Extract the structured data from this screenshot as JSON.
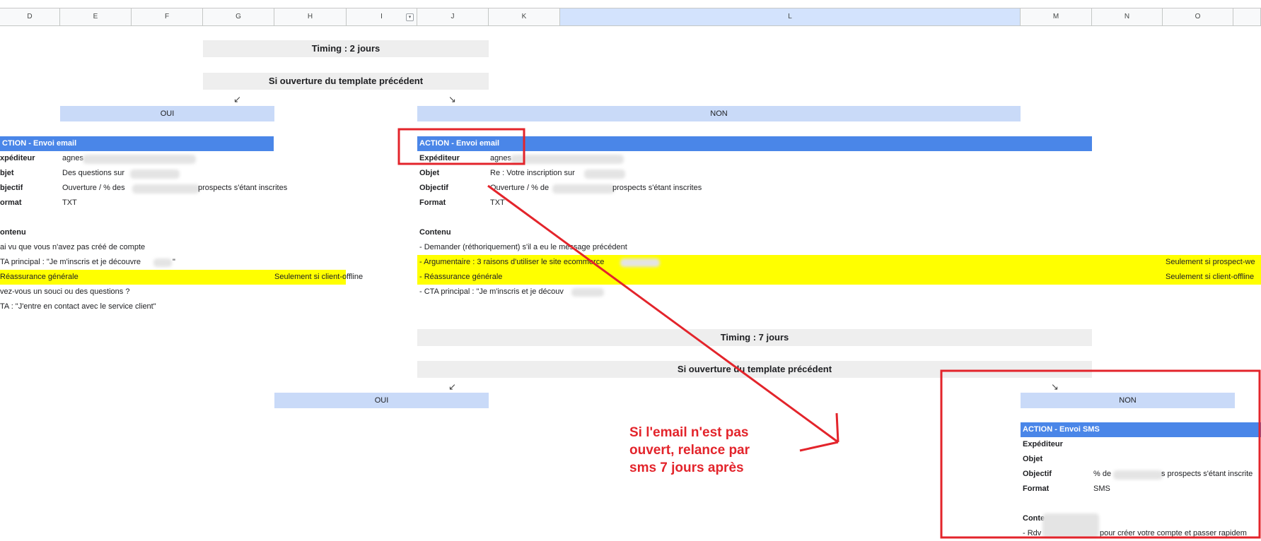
{
  "columns": [
    "D",
    "E",
    "F",
    "G",
    "H",
    "I",
    "J",
    "K",
    "L",
    "M",
    "N",
    "O"
  ],
  "timing1": "Timing : 2 jours",
  "condition1": "Si ouverture du template précédent",
  "arrow_down_left": "↙",
  "arrow_down_right": "↘",
  "branch_yes": "OUI",
  "branch_no": "NON",
  "left_block": {
    "action": "CTION -  Envoi email",
    "expediteur_label": "xpéditeur",
    "expediteur_value": "agnes",
    "objet_label": "bjet",
    "objet_value": "Des questions sur",
    "objectif_label": "bjectif",
    "objectif_value_a": "Ouverture / % des",
    "objectif_value_b": "prospects s'étant inscrites",
    "format_label": "ormat",
    "format_value": "TXT",
    "contenu_label": "ontenu",
    "lines": [
      "ai vu que vous n'avez pas créé de compte",
      "TA principal : \"Je m'inscris et je découvre",
      "Réassurance générale",
      "vez-vous un souci ou des questions ?",
      "TA : \"J'entre en contact avec le service client\""
    ],
    "quote_close": "\"",
    "note": "Seulement si client-offline"
  },
  "right_block": {
    "action": "ACTION -  Envoi email",
    "expediteur_label": "Expéditeur",
    "expediteur_value": "agnes",
    "objet_label": "Objet",
    "objet_value": "Re : Votre inscription sur",
    "objectif_label": "Objectif",
    "objectif_value_a": "Ouverture / % de",
    "objectif_value_b": "prospects s'étant inscrites",
    "format_label": "Format",
    "format_value": "TXT",
    "contenu_label": "Contenu",
    "lines": [
      "- Demander (réthoriquement) s'il a eu le message précédent",
      "- Argumentaire : 3 raisons d'utiliser le site ecommerce",
      "- Réassurance générale",
      "- CTA principal : \"Je m'inscris et je découv"
    ],
    "note1": "Seulement si prospect-we",
    "note2": "Seulement si client-offline"
  },
  "timing2": "Timing : 7 jours",
  "condition2": "Si ouverture du template précédent",
  "sms_block": {
    "action": "ACTION -  Envoi SMS",
    "expediteur_label": "Expéditeur",
    "objet_label": "Objet",
    "objectif_label": "Objectif",
    "objectif_value_a": "% de",
    "objectif_value_b": "s prospects s'étant inscrite",
    "format_label": "Format",
    "format_value": "SMS",
    "contenu_label": "Conte",
    "line_a": "- Rdv",
    "line_b": "pour créer votre compte et passer rapidem"
  },
  "annotation": "Si l'email n'est pas ouvert, relance par sms 7 jours après",
  "colors": {
    "action_blue": "#4a86e8",
    "branch_blue": "#c9daf8",
    "highlight_yellow": "#ffff00",
    "annotation_red": "#e3242b",
    "timing_gray": "#eeeeee"
  }
}
